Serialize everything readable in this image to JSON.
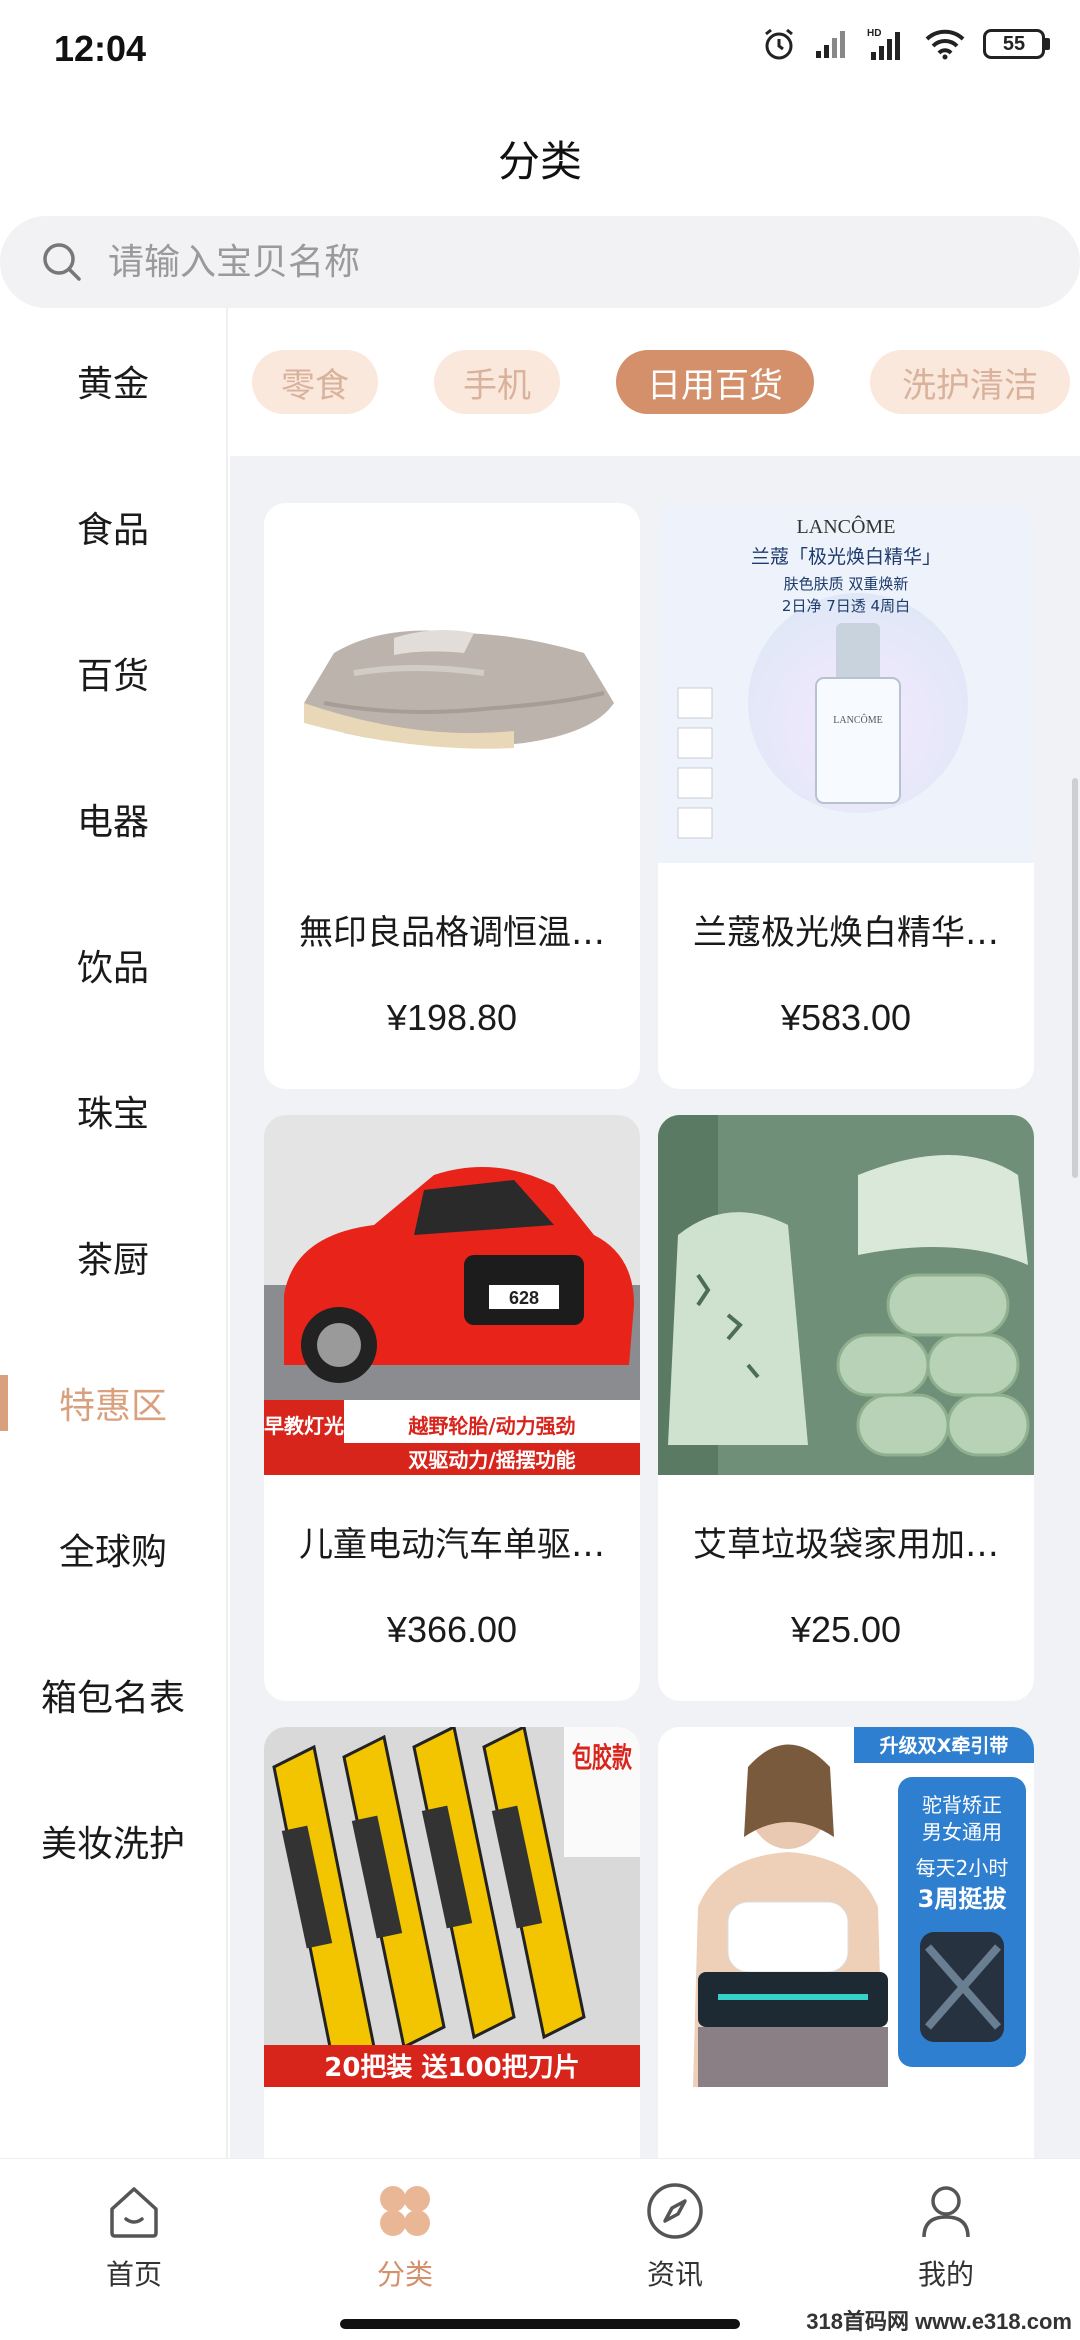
{
  "status_bar": {
    "time": "12:04",
    "battery": "55",
    "network": "HD"
  },
  "header": {
    "title": "分类"
  },
  "search": {
    "placeholder": "请输入宝贝名称"
  },
  "sidebar": {
    "items": [
      {
        "label": "黄金"
      },
      {
        "label": "食品"
      },
      {
        "label": "百货"
      },
      {
        "label": "电器"
      },
      {
        "label": "饮品"
      },
      {
        "label": "珠宝"
      },
      {
        "label": "茶厨"
      },
      {
        "label": "特惠区",
        "active": true
      },
      {
        "label": "全球购"
      },
      {
        "label": "箱包名表"
      },
      {
        "label": "美妆洗护"
      }
    ]
  },
  "tabs": [
    {
      "label": "零食"
    },
    {
      "label": "手机"
    },
    {
      "label": "日用百货",
      "active": true
    },
    {
      "label": "洗护清洁"
    }
  ],
  "products": [
    {
      "title": "無印良品格调恒温…",
      "price": "¥198.80",
      "image": "duvet"
    },
    {
      "title": "兰蔻极光焕白精华…",
      "price": "¥583.00",
      "image": "serum"
    },
    {
      "title": "儿童电动汽车单驱…",
      "price": "¥366.00",
      "image": "toy-car"
    },
    {
      "title": "艾草垃圾袋家用加…",
      "price": "¥25.00",
      "image": "trash-bags"
    },
    {
      "title": "",
      "price": "",
      "image": "utility-knives"
    },
    {
      "title": "",
      "price": "",
      "image": "posture-brace"
    }
  ],
  "image_text": {
    "serum_brand": "LANCÔME",
    "serum_headline": "兰蔻「极光焕白精华」",
    "serum_sub1": "肤色肤质 双重焕新",
    "serum_sub2": "2日净 7日透 4周白",
    "serum_bottle": "LANCÔME",
    "car_plate": "628",
    "car_banner_left": "早教灯光",
    "car_banner_1": "越野轮胎/动力强劲",
    "car_banner_2": "双驱动力/摇摆功能",
    "knife_tag": "包胶款",
    "knife_bottom": "20把装 送100把刀片",
    "brace_top": "升级双X牵引带",
    "brace_1": "驼背矫正",
    "brace_2": "男女通用",
    "brace_3": "每天2小时",
    "brace_4": "3周挺拔"
  },
  "bottom_nav": [
    {
      "label": "首页",
      "icon": "home-icon"
    },
    {
      "label": "分类",
      "icon": "category-icon",
      "active": true
    },
    {
      "label": "资讯",
      "icon": "compass-icon"
    },
    {
      "label": "我的",
      "icon": "profile-icon"
    }
  ],
  "watermark": "318首码网 www.e318.com",
  "colors": {
    "accent": "#d4906b",
    "chip_bg": "#fbe8dd",
    "active_text": "#d9a07e",
    "content_bg": "#f1f2f5"
  }
}
